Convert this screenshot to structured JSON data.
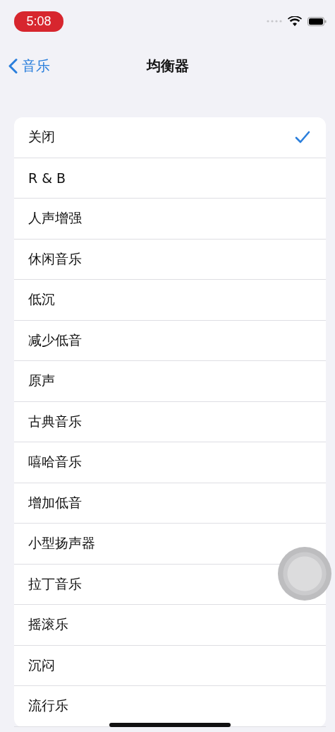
{
  "status_bar": {
    "time": "5:08"
  },
  "nav": {
    "back_label": "音乐",
    "title": "均衡器"
  },
  "presets": [
    {
      "label": "关闭",
      "selected": true
    },
    {
      "label": "R & B",
      "selected": false
    },
    {
      "label": "人声增强",
      "selected": false
    },
    {
      "label": "休闲音乐",
      "selected": false
    },
    {
      "label": "低沉",
      "selected": false
    },
    {
      "label": "减少低音",
      "selected": false
    },
    {
      "label": "原声",
      "selected": false
    },
    {
      "label": "古典音乐",
      "selected": false
    },
    {
      "label": "嘻哈音乐",
      "selected": false
    },
    {
      "label": "增加低音",
      "selected": false
    },
    {
      "label": "小型扬声器",
      "selected": false
    },
    {
      "label": "拉丁音乐",
      "selected": false
    },
    {
      "label": "摇滚乐",
      "selected": false
    },
    {
      "label": "沉闷",
      "selected": false
    },
    {
      "label": "流行乐",
      "selected": false
    }
  ]
}
